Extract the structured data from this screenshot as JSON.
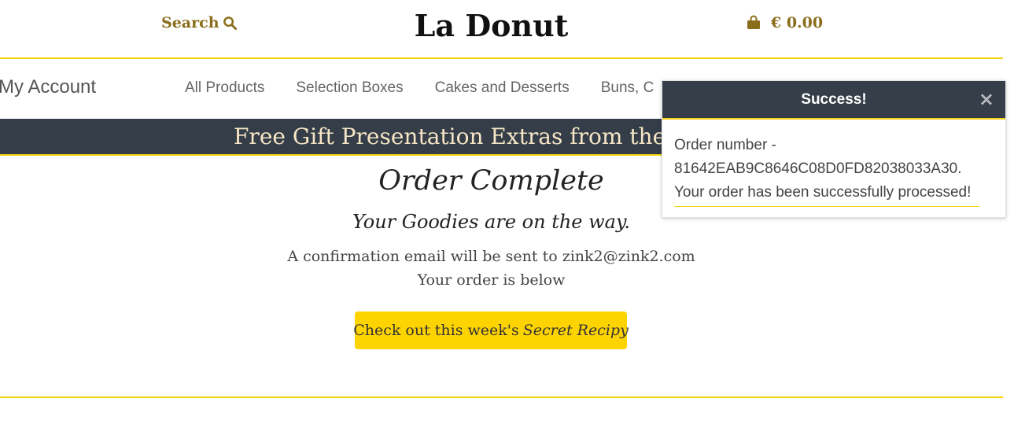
{
  "header": {
    "search_label": "Search",
    "logo": "La Donut",
    "bag_total": "€ 0.00",
    "accent_color": "#f5d30f",
    "icons": [
      "search-icon",
      "shopping-bag-icon"
    ]
  },
  "nav": {
    "account": "My Account",
    "items": [
      "All Products",
      "Selection Boxes",
      "Cakes and Desserts",
      "Buns, C"
    ]
  },
  "banner": {
    "text": "Free Gift Presentation Extras from the C"
  },
  "order": {
    "title": "Order Complete",
    "subtitle": "Your Goodies are on the way.",
    "email_line": "A confirmation email will be sent to zink2@zink2.com",
    "below_line": "Your order is below",
    "button_prefix": "Check out this week's",
    "button_italic": "Secret Recipy"
  },
  "toast": {
    "title": "Success!",
    "close": "×",
    "line1": "Order number -",
    "line2": "81642EAB9C8646C08D0FD82038033A30.",
    "line3": "Your order has been successfully processed!"
  }
}
